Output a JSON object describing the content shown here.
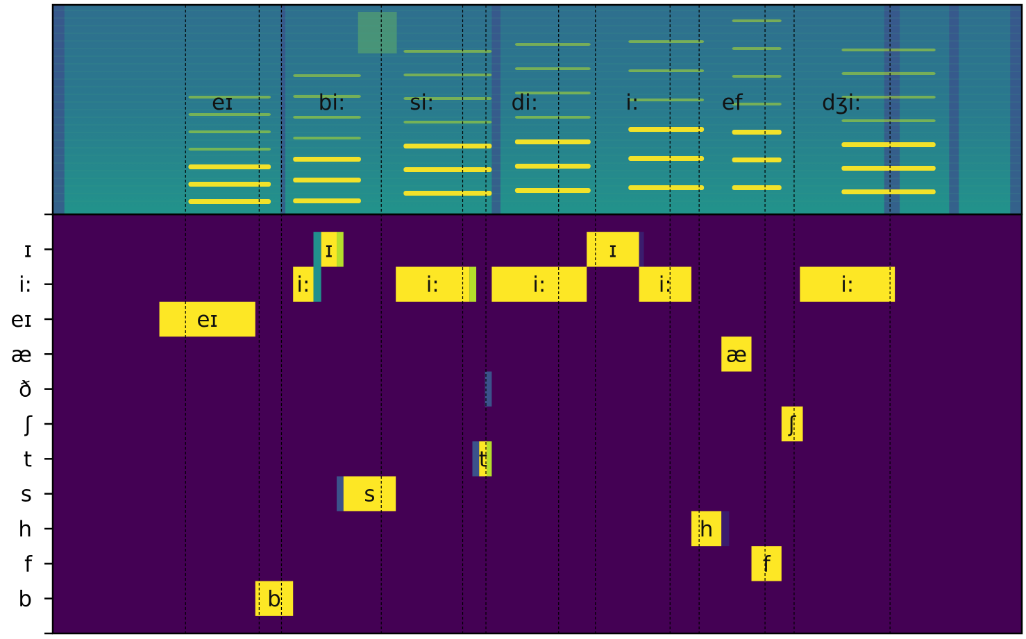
{
  "chart_data": [
    {
      "type": "heatmap",
      "name": "spectrogram",
      "x_range": [
        0,
        1000
      ],
      "y_range": [
        0,
        1
      ],
      "grid": false,
      "segment_boundaries": [
        137,
        213,
        236,
        339,
        423,
        447,
        522,
        560,
        637,
        667,
        735,
        765,
        864
      ],
      "segment_labels": [
        {
          "label": "eɪ",
          "x": 175
        },
        {
          "label": "bi:",
          "x": 288
        },
        {
          "label": "si:",
          "x": 381
        },
        {
          "label": "di:",
          "x": 487
        },
        {
          "label": "i:",
          "x": 598
        },
        {
          "label": "ef",
          "x": 701
        },
        {
          "label": "dʒi:",
          "x": 814
        }
      ],
      "colors": {
        "low": "#3b548c",
        "mid": "#21908d",
        "high": "#fde725"
      }
    },
    {
      "type": "heatmap",
      "name": "phoneme-posterior",
      "x_range": [
        0,
        1000
      ],
      "categories": [
        "ɪ",
        "i:",
        "eɪ",
        "æ",
        "ð",
        "ʃ",
        "t",
        "s",
        "h",
        "f",
        "b"
      ],
      "grid": false,
      "colors": {
        "background": "#440154",
        "high": "#fde725",
        "mid": "#21908d",
        "low": "#3b528b",
        "lime": "#b5de2b"
      },
      "cells": [
        {
          "row": "ɪ",
          "x0": 269,
          "x1": 277,
          "color": "#21908d"
        },
        {
          "row": "ɪ",
          "x0": 277,
          "x1": 293,
          "color": "#fde725",
          "label": "ɪ"
        },
        {
          "row": "ɪ",
          "x0": 293,
          "x1": 300,
          "color": "#b5de2b"
        },
        {
          "row": "ɪ",
          "x0": 551,
          "x1": 605,
          "color": "#fde725",
          "label": "ɪ"
        },
        {
          "row": "ɪ",
          "x0": 605,
          "x1": 610,
          "color": "#3b1c6e"
        },
        {
          "row": "i:",
          "x0": 248,
          "x1": 269,
          "color": "#fde725",
          "label": "i:"
        },
        {
          "row": "i:",
          "x0": 269,
          "x1": 277,
          "color": "#21908d"
        },
        {
          "row": "i:",
          "x0": 354,
          "x1": 430,
          "color": "#fde725",
          "label": "i:"
        },
        {
          "row": "i:",
          "x0": 430,
          "x1": 437,
          "color": "#b5de2b"
        },
        {
          "row": "i:",
          "x0": 453,
          "x1": 551,
          "color": "#fde725",
          "label": "i:"
        },
        {
          "row": "i:",
          "x0": 605,
          "x1": 659,
          "color": "#fde725",
          "label": "i:"
        },
        {
          "row": "i:",
          "x0": 771,
          "x1": 869,
          "color": "#fde725",
          "label": "i:"
        },
        {
          "row": "eɪ",
          "x0": 110,
          "x1": 209,
          "color": "#fde725",
          "label": "eɪ"
        },
        {
          "row": "æ",
          "x0": 690,
          "x1": 721,
          "color": "#fde725",
          "label": "æ"
        },
        {
          "row": "ð",
          "x0": 446,
          "x1": 453,
          "color": "#3b528b"
        },
        {
          "row": "ʃ",
          "x0": 752,
          "x1": 774,
          "color": "#fde725",
          "label": "ʃ"
        },
        {
          "row": "t",
          "x0": 433,
          "x1": 440,
          "color": "#3b528b"
        },
        {
          "row": "t",
          "x0": 440,
          "x1": 448,
          "color": "#fde725",
          "label": "t"
        },
        {
          "row": "t",
          "x0": 448,
          "x1": 453,
          "color": "#b5de2b"
        },
        {
          "row": "s",
          "x0": 293,
          "x1": 300,
          "color": "#3b528b"
        },
        {
          "row": "s",
          "x0": 300,
          "x1": 354,
          "color": "#fde725",
          "label": "s"
        },
        {
          "row": "h",
          "x0": 659,
          "x1": 690,
          "color": "#fde725",
          "label": "h"
        },
        {
          "row": "h",
          "x0": 690,
          "x1": 698,
          "color": "#3b1c6e"
        },
        {
          "row": "f",
          "x0": 721,
          "x1": 752,
          "color": "#fde725",
          "label": "f"
        },
        {
          "row": "b",
          "x0": 209,
          "x1": 248,
          "color": "#fde725",
          "label": "b"
        }
      ]
    }
  ]
}
